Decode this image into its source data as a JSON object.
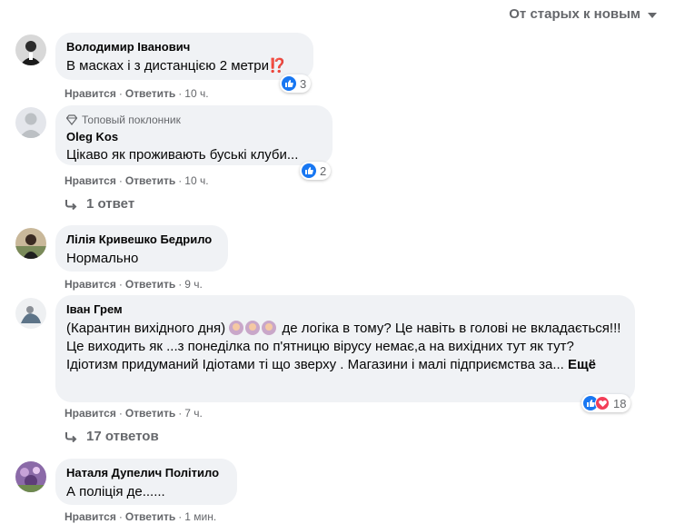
{
  "sort": {
    "label": "От старых к новым"
  },
  "comments": [
    {
      "author": "Володимир Іванович",
      "text": "В масках і з дистанцією 2 метри",
      "emoji": "⁉️",
      "like_label": "Нравится",
      "reply_label": "Ответить",
      "time": "10 ч.",
      "reactions": "3"
    },
    {
      "badge": "Топовый поклонник",
      "author": "Oleg Kos",
      "text": "Цікаво як проживають буські клуби...",
      "like_label": "Нравится",
      "reply_label": "Ответить",
      "time": "10 ч.",
      "reactions": "2",
      "replies": "1 ответ"
    },
    {
      "author": "Лілія Кривешко Бедрило",
      "text": "Нормально",
      "like_label": "Нравится",
      "reply_label": "Ответить",
      "time": "9 ч."
    },
    {
      "author": "Іван Грем",
      "text_start": "(Карантин вихідного дня) ",
      "text_rest": " де логіка в тому? Це навіть в голові не вкладається!!! Це виходить як ...з понеділка по п'ятницю вірусу немає,а на вихідних тут як тут? Ідіотизм придуманий Ідіотами ті що зверху . Магазини і малі підприємства за...",
      "more_label": "Ещё",
      "like_label": "Нравится",
      "reply_label": "Ответить",
      "time": "7 ч.",
      "reactions": "18",
      "replies": "17 ответов"
    },
    {
      "author": "Наталя Дупелич Політило",
      "text": "А поліція де......",
      "like_label": "Нравится",
      "reply_label": "Ответить",
      "time": "1 мин."
    }
  ],
  "colors": {
    "like": "#1877f2",
    "love": "#f33e58",
    "bubble": "#f0f2f5",
    "meta": "#65676b"
  }
}
